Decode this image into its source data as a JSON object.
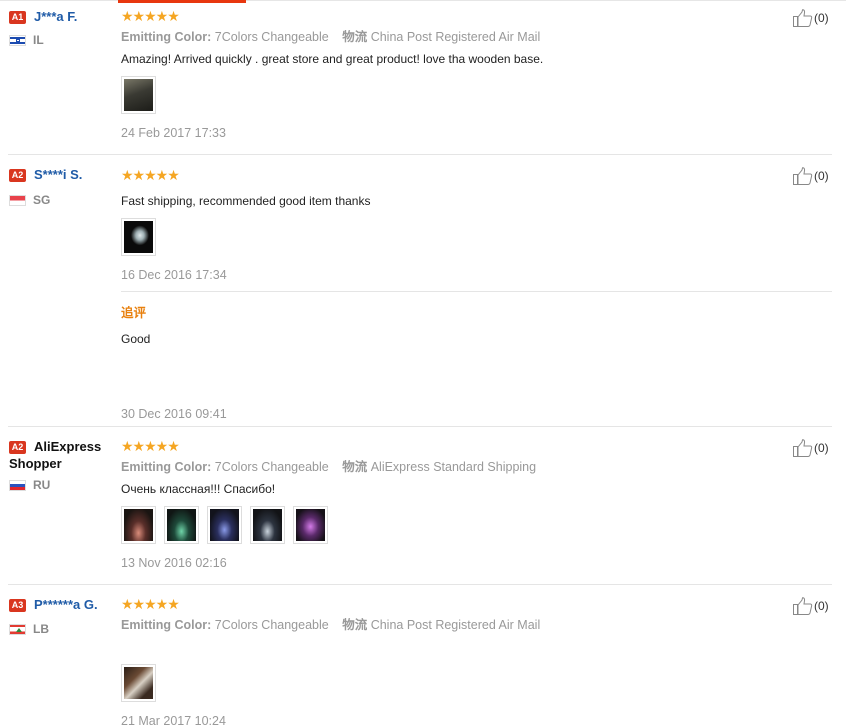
{
  "reviews": [
    {
      "level": "A1",
      "name": "J***a F.",
      "country": "IL",
      "flag": "il",
      "stars": "★★★★★",
      "color_label": "Emitting Color:",
      "color_value": "7Colors Changeable",
      "logistics_label": "物流",
      "logistics_value": "China Post Registered Air Mail",
      "text": "Amazing! Arrived quickly . great store and great product! love tha wooden base.",
      "date": "24 Feb 2017 17:33",
      "helpful": "(0)",
      "photos": [
        "#3a3a33"
      ]
    },
    {
      "level": "A2",
      "name": "S****i S.",
      "country": "SG",
      "flag": "sg",
      "stars": "★★★★★",
      "text": "Fast shipping, recommended good item thanks",
      "date": "16 Dec 2016 17:34",
      "helpful": "(0)",
      "photos": [
        "#0a0a0a"
      ],
      "followup": {
        "label": "追评",
        "text": "Good",
        "date": "30 Dec 2016 09:41"
      }
    },
    {
      "level": "A2",
      "name": "AliExpress Shopper",
      "name_line1": "AliExpress",
      "name_line2": "Shopper",
      "country": "RU",
      "flag": "ru",
      "stars": "★★★★★",
      "color_label": "Emitting Color:",
      "color_value": "7Colors Changeable",
      "logistics_label": "物流",
      "logistics_value": "AliExpress Standard Shipping",
      "text": "Очень классная!!! Спасибо!",
      "date": "13 Nov 2016 02:16",
      "helpful": "(0)",
      "photos": [
        "#5a2f2a",
        "#1e4a3a",
        "#2a2f5e",
        "#2d3440",
        "#5a2a6a"
      ]
    },
    {
      "level": "A3",
      "name": "P******a G.",
      "country": "LB",
      "flag": "lb",
      "stars": "★★★★★",
      "color_label": "Emitting Color:",
      "color_value": "7Colors Changeable",
      "logistics_label": "物流",
      "logistics_value": "China Post Registered Air Mail",
      "text": "",
      "date": "21 Mar 2017 10:24",
      "helpful": "(0)",
      "photos": [
        "#4a3628"
      ]
    }
  ],
  "colors": {
    "accent": "#e8370f",
    "star": "#f5a623",
    "buyer_name": "#1f5ba7",
    "followup_label": "#e8800e",
    "level_badge": "#d9361f"
  }
}
